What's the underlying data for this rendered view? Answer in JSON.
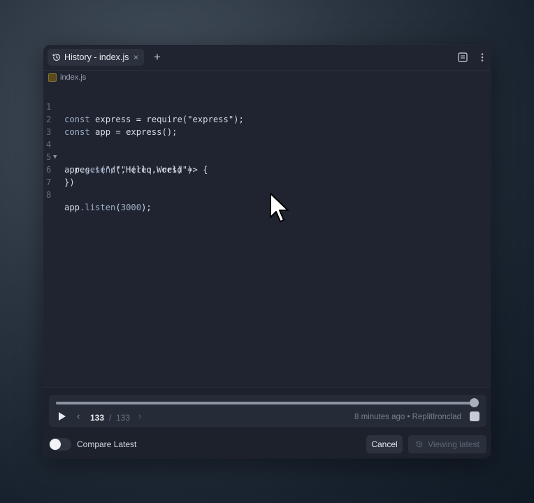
{
  "tab": {
    "title": "History - index.js",
    "close": "×"
  },
  "add_tab": "+",
  "file": {
    "name": "index.js"
  },
  "editor": {
    "line_numbers": [
      "1",
      "2",
      "3",
      "4",
      "5",
      "6",
      "7",
      "8"
    ],
    "fold_marker": "▼"
  },
  "player": {
    "position": 133,
    "total": 133,
    "current": "133",
    "separator": "/",
    "total_label": "133",
    "prev": "‹",
    "next": "›",
    "meta": "8 minutes ago  • ReplitIronclad"
  },
  "compare": {
    "label": "Compare Latest",
    "enabled": false
  },
  "buttons": {
    "cancel": "Cancel",
    "viewing": "Viewing latest"
  },
  "code_tokens": {
    "l1_a": "const ",
    "l1_b": "express",
    "l1_c": " = ",
    "l1_d": "require",
    "l1_e": "(\"express\");",
    "l2_a": "const ",
    "l2_b": "app",
    "l2_c": " = ",
    "l2_d": "express",
    "l2_e": "();",
    "l4_a": "app",
    "l4_b": ".get",
    "l4_c": "(\"/\", (req, res) => {",
    "l5_a": "  res",
    "l5_b": ".send",
    "l5_c": "(\"Hello World\")",
    "l6": "})",
    "l8_a": "app",
    "l8_b": ".listen",
    "l8_c": "(",
    "l8_d": "3000",
    "l8_e": ");"
  },
  "colors": {
    "accent": "#e6e9ee",
    "panel": "#1f2430",
    "muted": "#767f8e"
  }
}
